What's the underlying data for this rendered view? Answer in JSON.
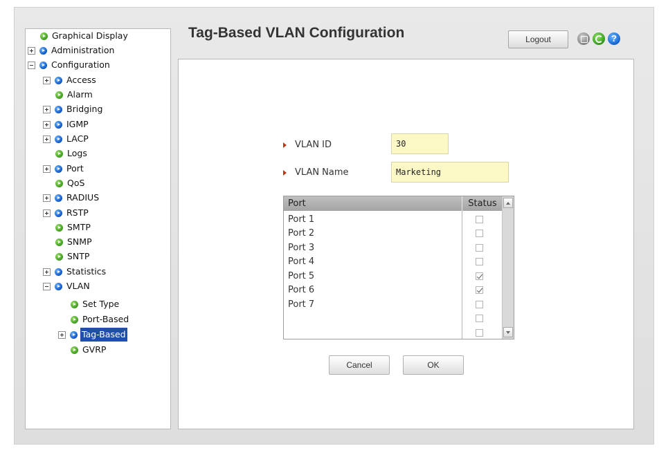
{
  "header": {
    "title": "Tag-Based VLAN Configuration",
    "logout_label": "Logout",
    "help_glyph": "?"
  },
  "sidebar": {
    "items": [
      {
        "label": "Graphical Display",
        "icon": "green",
        "expander": null,
        "selected": false
      },
      {
        "label": "Administration",
        "icon": "blue",
        "expander": "plus",
        "selected": false
      },
      {
        "label": "Configuration",
        "icon": "blue",
        "expander": "minus",
        "selected": false
      },
      {
        "label": "Access",
        "icon": "blue",
        "expander": "plus",
        "selected": false
      },
      {
        "label": "Alarm",
        "icon": "green",
        "expander": null,
        "selected": false
      },
      {
        "label": "Bridging",
        "icon": "blue",
        "expander": "plus",
        "selected": false
      },
      {
        "label": "IGMP",
        "icon": "blue",
        "expander": "plus",
        "selected": false
      },
      {
        "label": "LACP",
        "icon": "blue",
        "expander": "plus",
        "selected": false
      },
      {
        "label": "Logs",
        "icon": "green",
        "expander": null,
        "selected": false
      },
      {
        "label": "Port",
        "icon": "blue",
        "expander": "plus",
        "selected": false
      },
      {
        "label": "QoS",
        "icon": "green",
        "expander": null,
        "selected": false
      },
      {
        "label": "RADIUS",
        "icon": "blue",
        "expander": "plus",
        "selected": false
      },
      {
        "label": "RSTP",
        "icon": "blue",
        "expander": "plus",
        "selected": false
      },
      {
        "label": "SMTP",
        "icon": "green",
        "expander": null,
        "selected": false
      },
      {
        "label": "SNMP",
        "icon": "green",
        "expander": null,
        "selected": false
      },
      {
        "label": "SNTP",
        "icon": "green",
        "expander": null,
        "selected": false
      },
      {
        "label": "Statistics",
        "icon": "blue",
        "expander": "plus",
        "selected": false
      },
      {
        "label": "VLAN",
        "icon": "blue",
        "expander": "minus",
        "selected": false
      },
      {
        "label": "Set Type",
        "icon": "green",
        "expander": null,
        "selected": false
      },
      {
        "label": "Port-Based",
        "icon": "green",
        "expander": null,
        "selected": false
      },
      {
        "label": "Tag-Based",
        "icon": "blue",
        "expander": "plus",
        "selected": true
      },
      {
        "label": "GVRP",
        "icon": "green",
        "expander": null,
        "selected": false
      }
    ]
  },
  "form": {
    "vlan_id_label": "VLAN ID",
    "vlan_id_value": "30",
    "vlan_name_label": "VLAN Name",
    "vlan_name_value": "Marketing"
  },
  "port_table": {
    "headers": {
      "port": "Port",
      "status": "Status"
    },
    "rows": [
      {
        "port": "Port 1",
        "checked": false
      },
      {
        "port": "Port 2",
        "checked": false
      },
      {
        "port": "Port 3",
        "checked": false
      },
      {
        "port": "Port 4",
        "checked": false
      },
      {
        "port": "Port 5",
        "checked": true
      },
      {
        "port": "Port 6",
        "checked": true
      },
      {
        "port": "Port 7",
        "checked": false
      },
      {
        "port": "",
        "checked": false
      },
      {
        "port": "",
        "checked": false
      }
    ]
  },
  "buttons": {
    "cancel_label": "Cancel",
    "ok_label": "OK"
  },
  "colors": {
    "selected_bg": "#1f4fa8",
    "input_bg": "#fcf9c7",
    "field_arrow": "#b33a1f"
  }
}
